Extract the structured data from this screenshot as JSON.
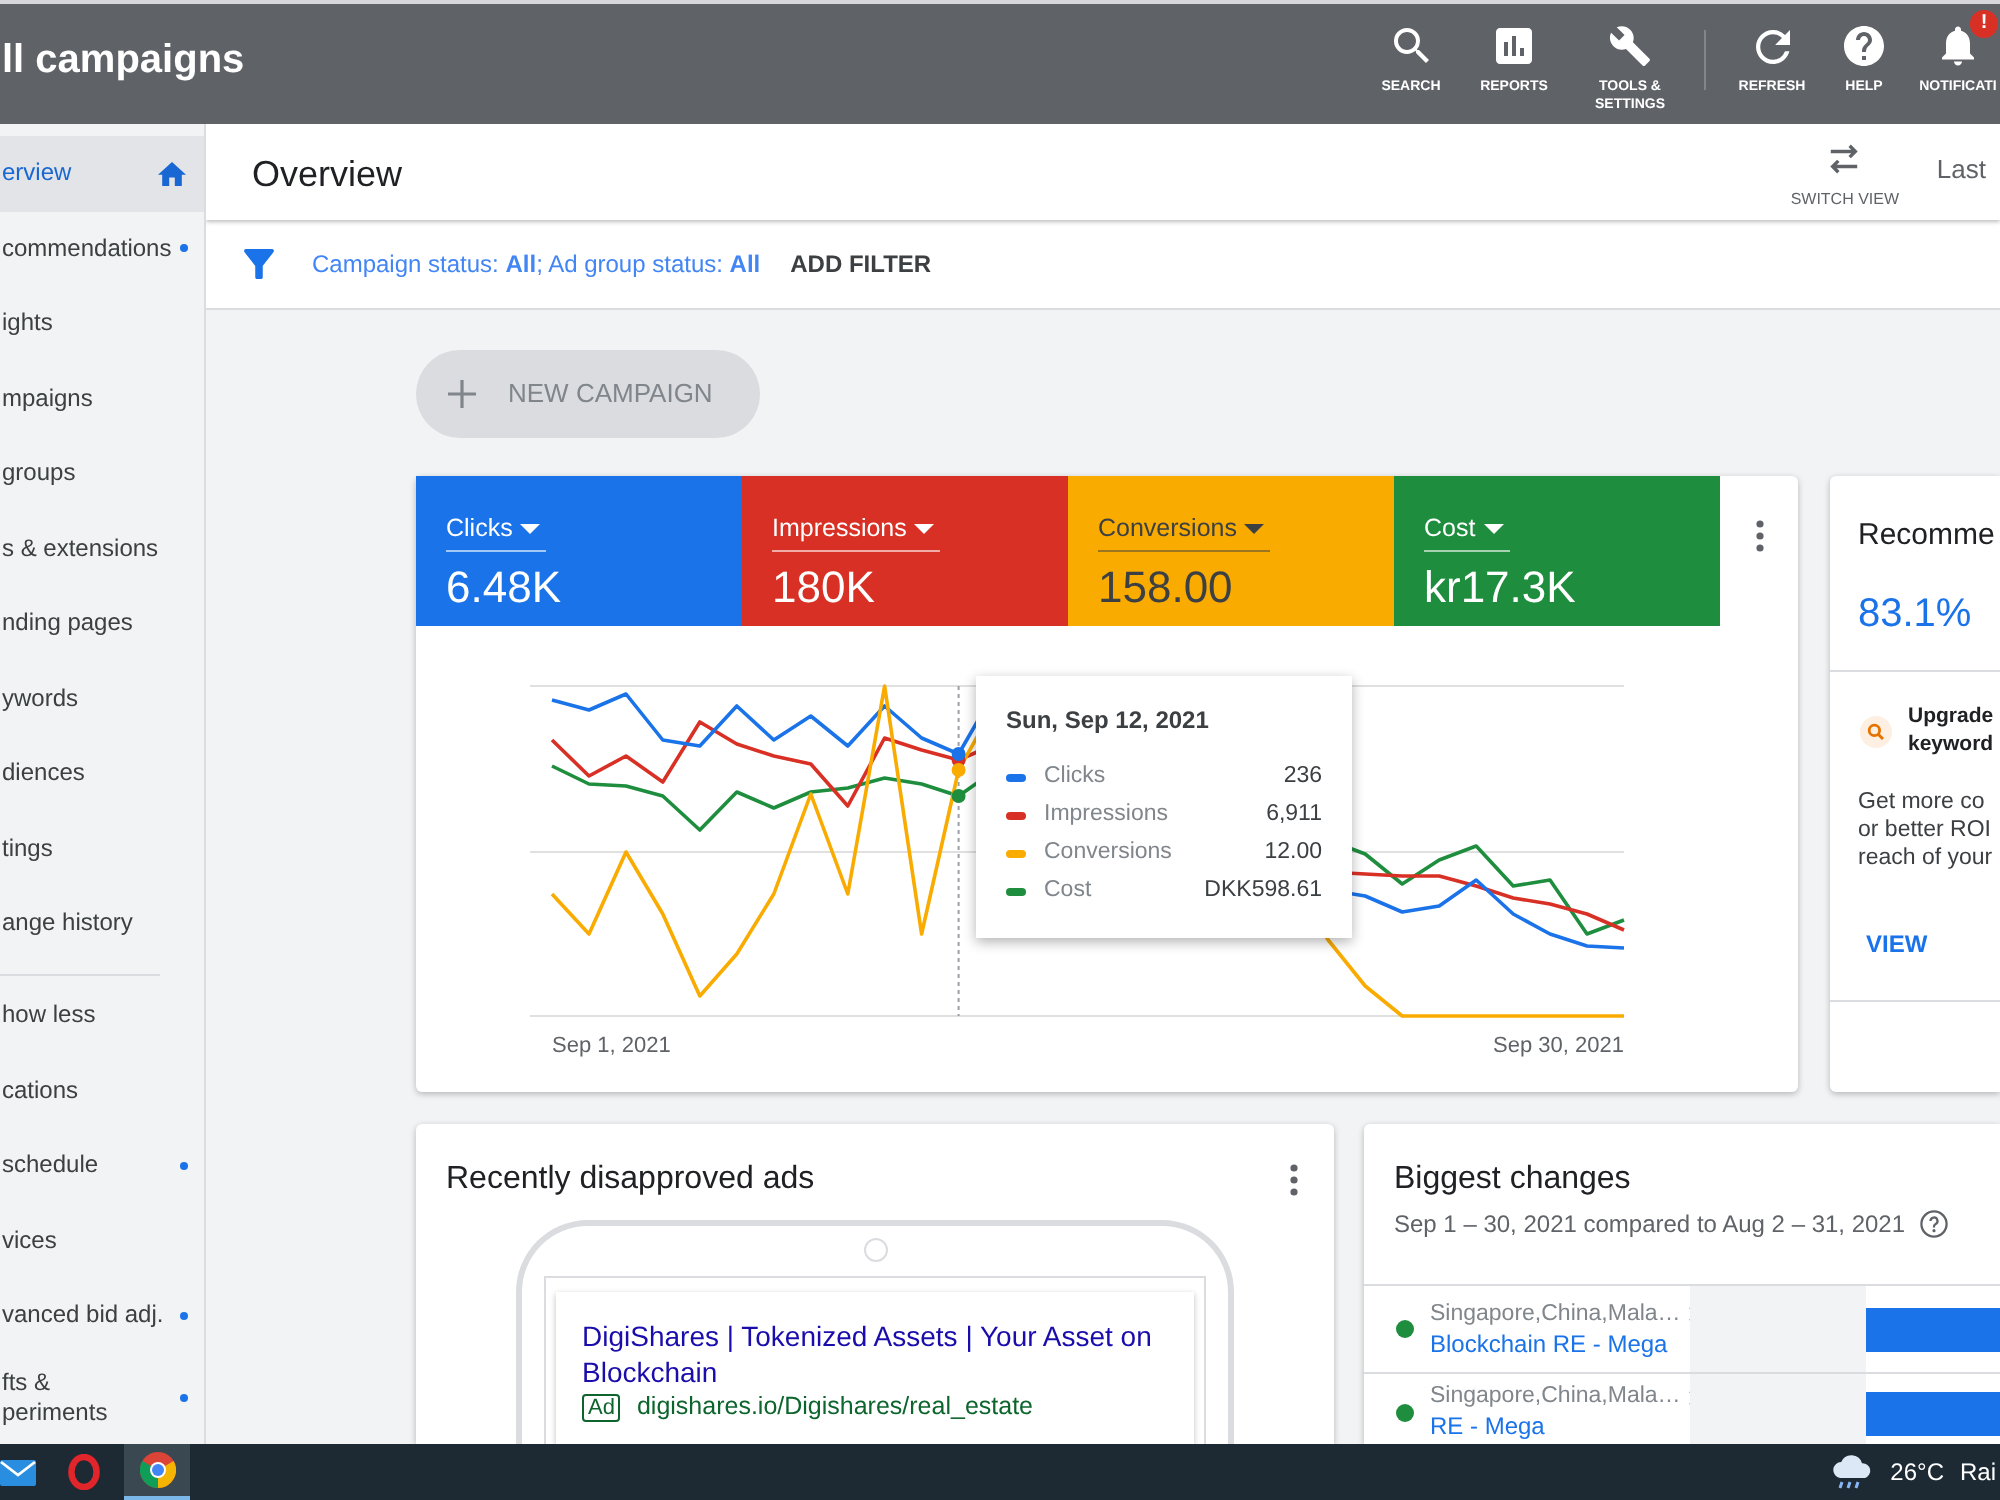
{
  "top_bar": {
    "title": "ll campaigns",
    "action_groups": [
      {
        "actions": [
          {
            "label": "SEARCH"
          },
          {
            "label": "REPORTS"
          },
          {
            "label": "TOOLS & SETTINGS"
          }
        ]
      },
      {
        "actions": [
          {
            "label": "REFRESH"
          },
          {
            "label": "HELP"
          },
          {
            "label": "NOTIFICATI",
            "badge": "!"
          }
        ]
      }
    ]
  },
  "sidebar": {
    "sections": [
      {
        "items": [
          {
            "label": "erview",
            "selected": true,
            "dot": false
          },
          {
            "label": "commendations",
            "selected": false,
            "dot": true
          },
          {
            "label": "ights",
            "selected": false,
            "dot": false
          },
          {
            "label": "mpaigns",
            "selected": false,
            "dot": false
          },
          {
            "label": "groups",
            "selected": false,
            "dot": false
          },
          {
            "label": "s & extensions",
            "selected": false,
            "dot": false
          },
          {
            "label": "nding pages",
            "selected": false,
            "dot": false
          },
          {
            "label": "ywords",
            "selected": false,
            "dot": false
          },
          {
            "label": "diences",
            "selected": false,
            "dot": false
          },
          {
            "label": "tings",
            "selected": false,
            "dot": false
          },
          {
            "label": "ange history",
            "selected": false,
            "dot": false
          }
        ]
      },
      {
        "items": [
          {
            "label": "how less",
            "selected": false,
            "dot": false
          },
          {
            "label": "cations",
            "selected": false,
            "dot": false
          },
          {
            "label": "schedule",
            "selected": false,
            "dot": true
          },
          {
            "label": "vices",
            "selected": false,
            "dot": false
          },
          {
            "label": "vanced bid adj.",
            "selected": false,
            "dot": true
          },
          {
            "label": "fts &\nperiments",
            "selected": false,
            "dot": true
          }
        ]
      }
    ]
  },
  "header": {
    "title": "Overview",
    "switch_view": "SWITCH VIEW",
    "date_range": "Last"
  },
  "filter_bar": {
    "text": "Campaign status: **All**; Ad group status: **All**",
    "add_filter": "ADD FILTER"
  },
  "new_campaign": {
    "label": "NEW CAMPAIGN",
    "disabled": true
  },
  "performance": {
    "metrics": [
      {
        "label": "Clicks",
        "value": "6.48K",
        "color": "#1a73e8",
        "selected": true
      },
      {
        "label": "Impressions",
        "value": "180K",
        "color": "#d93025",
        "selected": true
      },
      {
        "label": "Conversions",
        "value": "158.00",
        "color": "#f9ab00",
        "selected": true
      },
      {
        "label": "Cost",
        "value": "kr17.3K",
        "color": "#1e8e3e",
        "selected": true
      }
    ],
    "x_labels": [
      "Sep 1, 2021",
      "Sep 30, 2021"
    ],
    "tooltip": {
      "date": "Sun, Sep 12, 2021",
      "rows": [
        {
          "name": "Clicks",
          "value": "236",
          "color": "#1a73e8"
        },
        {
          "name": "Impressions",
          "value": "6,911",
          "color": "#d93025"
        },
        {
          "name": "Conversions",
          "value": "12.00",
          "color": "#f9ab00"
        },
        {
          "name": "Cost",
          "value": "DKK598.61",
          "color": "#1e8e3e"
        }
      ]
    }
  },
  "recommendations": {
    "title": "Recomme",
    "score": "83.1%",
    "card": {
      "title_lines": [
        "Upgrade",
        "keyword"
      ],
      "body_lines": [
        "Get more co",
        "or better ROI",
        "reach of your"
      ],
      "action": "VIEW"
    }
  },
  "disapproved_ads": {
    "title": "Recently disapproved ads",
    "ad": {
      "headline": "DigiShares | Tokenized Assets | Your Asset on Blockchain",
      "badge": "Ad",
      "url": "digishares.io/Digishares/real_estate"
    }
  },
  "biggest_changes": {
    "title": "Biggest changes",
    "subtitle": "Sep 1 – 30, 2021 compared to Aug 2 – 31, 2021",
    "rows": [
      {
        "location": "Singapore,China,Mala…",
        "campaign": "Blockchain RE - Mega",
        "color": "#1e8e3e"
      },
      {
        "location": "Singapore,China,Mala…",
        "campaign": "RE - Mega",
        "color": "#1e8e3e"
      }
    ]
  },
  "taskbar": {
    "apps": [
      {
        "selected": false
      },
      {
        "selected": false
      },
      {
        "selected": true
      }
    ],
    "temperature": "26°C",
    "weather": "Rai"
  }
}
